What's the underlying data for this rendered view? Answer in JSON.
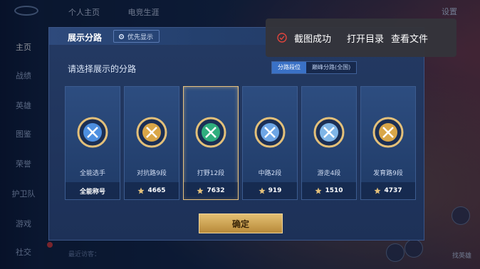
{
  "background": {
    "top_tabs": [
      "个人主页",
      "电竞生涯"
    ],
    "settings": "设置",
    "nav": [
      {
        "label": "主页",
        "active": true
      },
      {
        "label": "战绩",
        "active": false
      },
      {
        "label": "英雄",
        "active": false
      },
      {
        "label": "图鉴",
        "active": false
      },
      {
        "label": "荣誉",
        "active": false
      },
      {
        "label": "护卫队",
        "active": false
      },
      {
        "label": "游戏",
        "active": false
      },
      {
        "label": "社交",
        "active": false
      }
    ],
    "recent_visits": "最近访客：",
    "share": "找英雄"
  },
  "modal": {
    "title": "展示分路",
    "priority_button": "优先显示",
    "prompt": "请选择展示的分路",
    "tabs": [
      {
        "label": "分路段位",
        "active": true
      },
      {
        "label": "巅峰分路(全国)",
        "active": false
      }
    ],
    "cards": [
      {
        "label": "全能选手",
        "foot": "全能称号",
        "has_star": false,
        "selected": false,
        "emblem_color": "#4d8fe0"
      },
      {
        "label": "对抗路9段",
        "foot": "4665",
        "has_star": true,
        "selected": false,
        "emblem_color": "#d9a648"
      },
      {
        "label": "打野12段",
        "foot": "7632",
        "has_star": true,
        "selected": true,
        "emblem_color": "#2fae7e"
      },
      {
        "label": "中路2段",
        "foot": "919",
        "has_star": true,
        "selected": false,
        "emblem_color": "#6ea6e6"
      },
      {
        "label": "游走4段",
        "foot": "1510",
        "has_star": true,
        "selected": false,
        "emblem_color": "#7fb6e8"
      },
      {
        "label": "发育路9段",
        "foot": "4737",
        "has_star": true,
        "selected": false,
        "emblem_color": "#d9a648"
      }
    ],
    "confirm": "确定"
  },
  "toast": {
    "message": "截图成功",
    "open_dir": "打开目录",
    "view_file": "查看文件"
  },
  "colors": {
    "accent_gold": "#e3bf72",
    "tab_active": "#3a71c6",
    "toast_ok": "#e0443c"
  }
}
